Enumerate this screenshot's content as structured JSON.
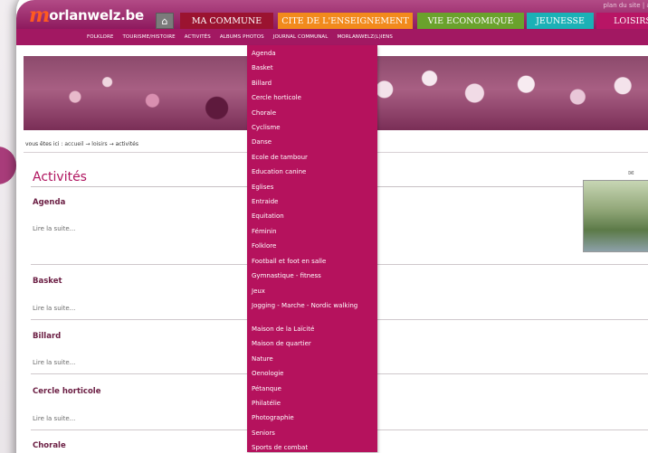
{
  "header": {
    "logo_letter": "m",
    "logo_text": "orlanwelz.be",
    "site_links": "plan du site | access",
    "tabs": [
      {
        "label": "MA COMMUNE",
        "color": "#9b1330"
      },
      {
        "label": "CITE DE L'ENSEIGNEMENT",
        "color": "#f28a1c"
      },
      {
        "label": "VIE ECONOMIQUE",
        "color": "#6aa22c"
      },
      {
        "label": "JEUNESSE",
        "color": "#1bb1b6"
      },
      {
        "label": "LOISIRS",
        "color": "#b81565"
      }
    ]
  },
  "subnav": {
    "items": [
      "FOLKLORE",
      "TOURISME/HISTOIRE",
      "ACTIVITÉS",
      "ALBUMS PHOTOS",
      "JOURNAL COMMUNAL",
      "MORLANWELZ(L)IENS"
    ]
  },
  "breadcrumb": {
    "prefix": "vous êtes ici :",
    "accueil": "accueil",
    "loisirs": "loisirs",
    "current": "activités",
    "separator": "→"
  },
  "content": {
    "page_title": "Activités",
    "items": [
      {
        "title": "Agenda",
        "more": "Lire la suite..."
      },
      {
        "title": "Basket",
        "more": "Lire la suite..."
      },
      {
        "title": "Billard",
        "more": "Lire la suite..."
      },
      {
        "title": "Cercle horticole",
        "more": "Lire la suite..."
      },
      {
        "title": "Chorale",
        "more": ""
      }
    ]
  },
  "dropdown": {
    "items": [
      "Agenda",
      "Basket",
      "Billard",
      "Cercle horticole",
      "Chorale",
      "Cyclisme",
      "Danse",
      "Ecole de tambour",
      "Education canine",
      "Eglises",
      "Entraide",
      "Equitation",
      "Féminin",
      "Folklore",
      "Football et foot en salle",
      "Gymnastique - fitness",
      "Jeux",
      "Jogging - Marche - Nordic walking",
      "Maison de la Laïcité",
      "Maison de quartier",
      "Nature",
      "Oenologie",
      "Pétanque",
      "Philatélie",
      "Photographie",
      "Seniors",
      "Sports de combat"
    ]
  },
  "colors": {
    "brand_magenta": "#b5125d",
    "title_color": "#b0145f"
  }
}
